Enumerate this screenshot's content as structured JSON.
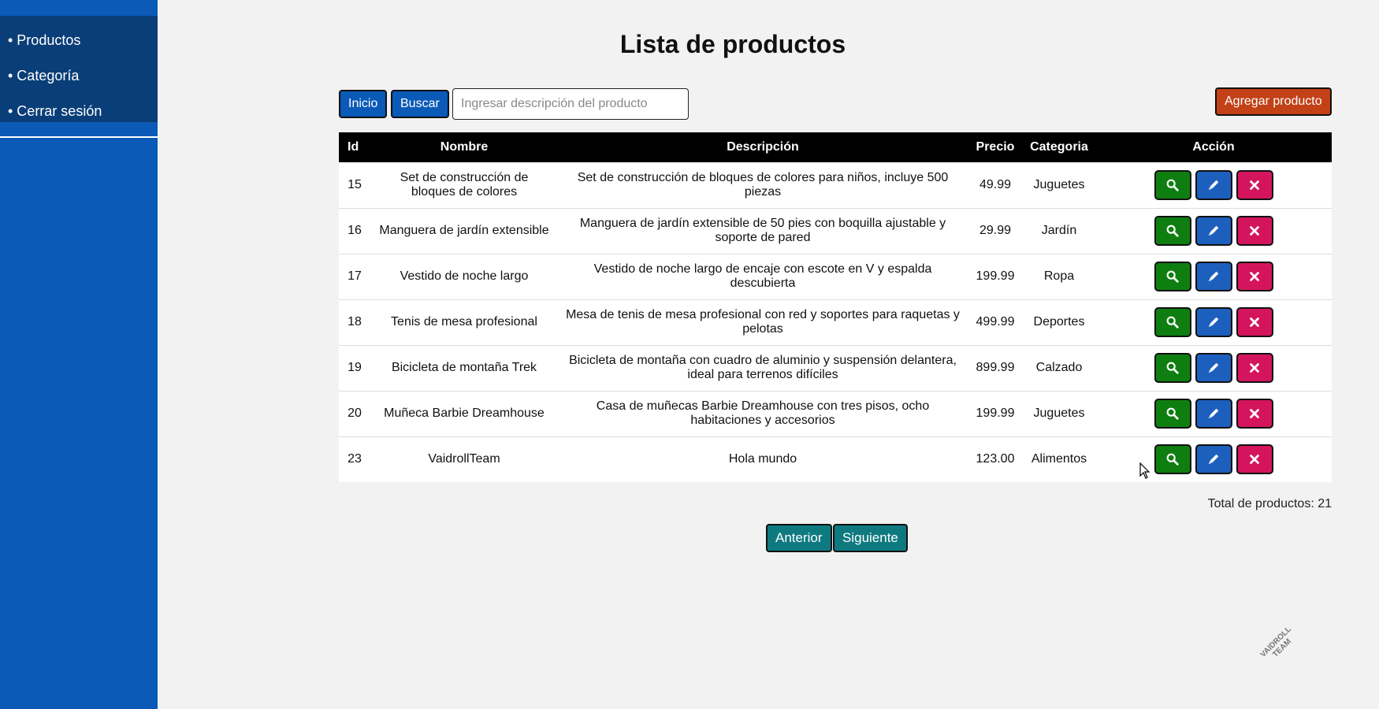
{
  "sidebar": {
    "items": [
      {
        "label": "• Productos"
      },
      {
        "label": "• Categoría"
      },
      {
        "label": "• Cerrar sesión"
      }
    ]
  },
  "page": {
    "title": "Lista de productos"
  },
  "toolbar": {
    "home_label": "Inicio",
    "search_label": "Buscar",
    "search_placeholder": "Ingresar descripción del producto",
    "add_label": "Agregar producto"
  },
  "table": {
    "headers": {
      "id": "Id",
      "name": "Nombre",
      "description": "Descripción",
      "price": "Precio",
      "category": "Categoria",
      "action": "Acción"
    },
    "rows": [
      {
        "id": "15",
        "name": "Set de construcción de bloques de colores",
        "description": "Set de construcción de bloques de colores para niños, incluye 500 piezas",
        "price": "49.99",
        "category": "Juguetes"
      },
      {
        "id": "16",
        "name": "Manguera de jardín extensible",
        "description": "Manguera de jardín extensible de 50 pies con boquilla ajustable y soporte de pared",
        "price": "29.99",
        "category": "Jardín"
      },
      {
        "id": "17",
        "name": "Vestido de noche largo",
        "description": "Vestido de noche largo de encaje con escote en V y espalda descubierta",
        "price": "199.99",
        "category": "Ropa"
      },
      {
        "id": "18",
        "name": "Tenis de mesa profesional",
        "description": "Mesa de tenis de mesa profesional con red y soportes para raquetas y pelotas",
        "price": "499.99",
        "category": "Deportes"
      },
      {
        "id": "19",
        "name": "Bicicleta de montaña Trek",
        "description": "Bicicleta de montaña con cuadro de aluminio y suspensión delantera, ideal para terrenos difíciles",
        "price": "899.99",
        "category": "Calzado"
      },
      {
        "id": "20",
        "name": "Muñeca Barbie Dreamhouse",
        "description": "Casa de muñecas Barbie Dreamhouse con tres pisos, ocho habitaciones y accesorios",
        "price": "199.99",
        "category": "Juguetes"
      },
      {
        "id": "23",
        "name": "VaidrollTeam",
        "description": "Hola mundo",
        "price": "123.00",
        "category": "Alimentos"
      }
    ]
  },
  "footer": {
    "total_text": "Total de productos: 21",
    "prev_label": "Anterior",
    "next_label": "Siguiente"
  },
  "watermark": {
    "line1": "VAIDROLL",
    "line2": "TEAM"
  },
  "colors": {
    "sidebar": "#0b5ab8",
    "sidebar_menu": "#0a3e78",
    "view": "#0e7e10",
    "edit": "#1d5fbd",
    "delete": "#d4155e",
    "add": "#c24116",
    "pager": "#0e7a80"
  }
}
